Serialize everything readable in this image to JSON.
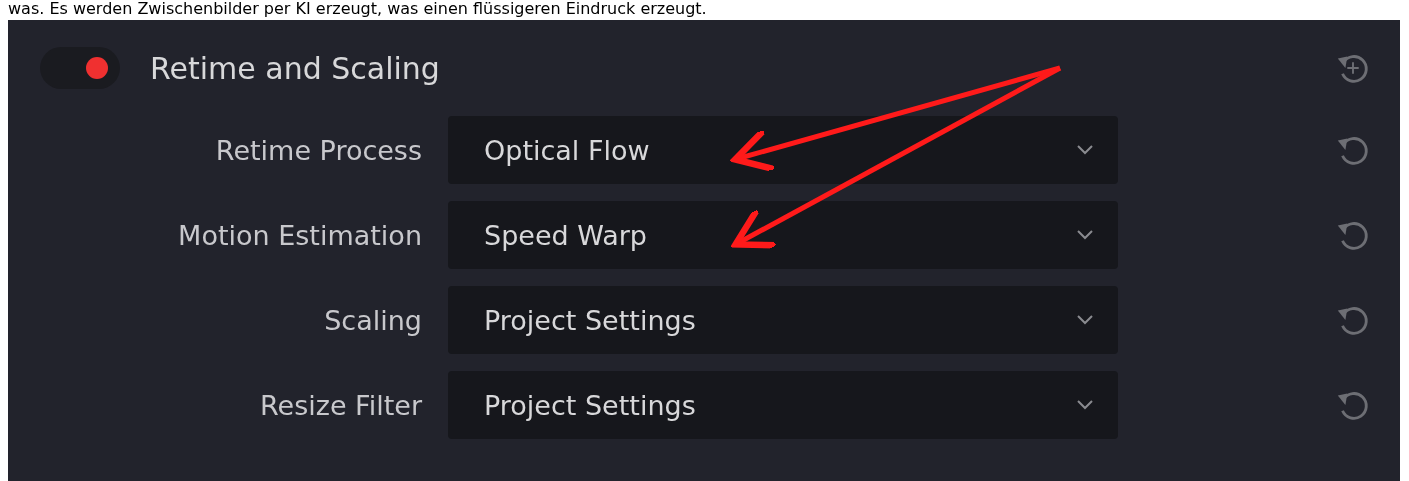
{
  "caption": "was. Es werden Zwischenbilder per KI erzeugt, was einen flüssigeren Eindruck erzeugt.",
  "section": {
    "title": "Retime and Scaling",
    "enabled": true
  },
  "rows": [
    {
      "label": "Retime Process",
      "value": "Optical Flow"
    },
    {
      "label": "Motion Estimation",
      "value": "Speed Warp"
    },
    {
      "label": "Scaling",
      "value": "Project Settings"
    },
    {
      "label": "Resize Filter",
      "value": "Project Settings"
    }
  ]
}
